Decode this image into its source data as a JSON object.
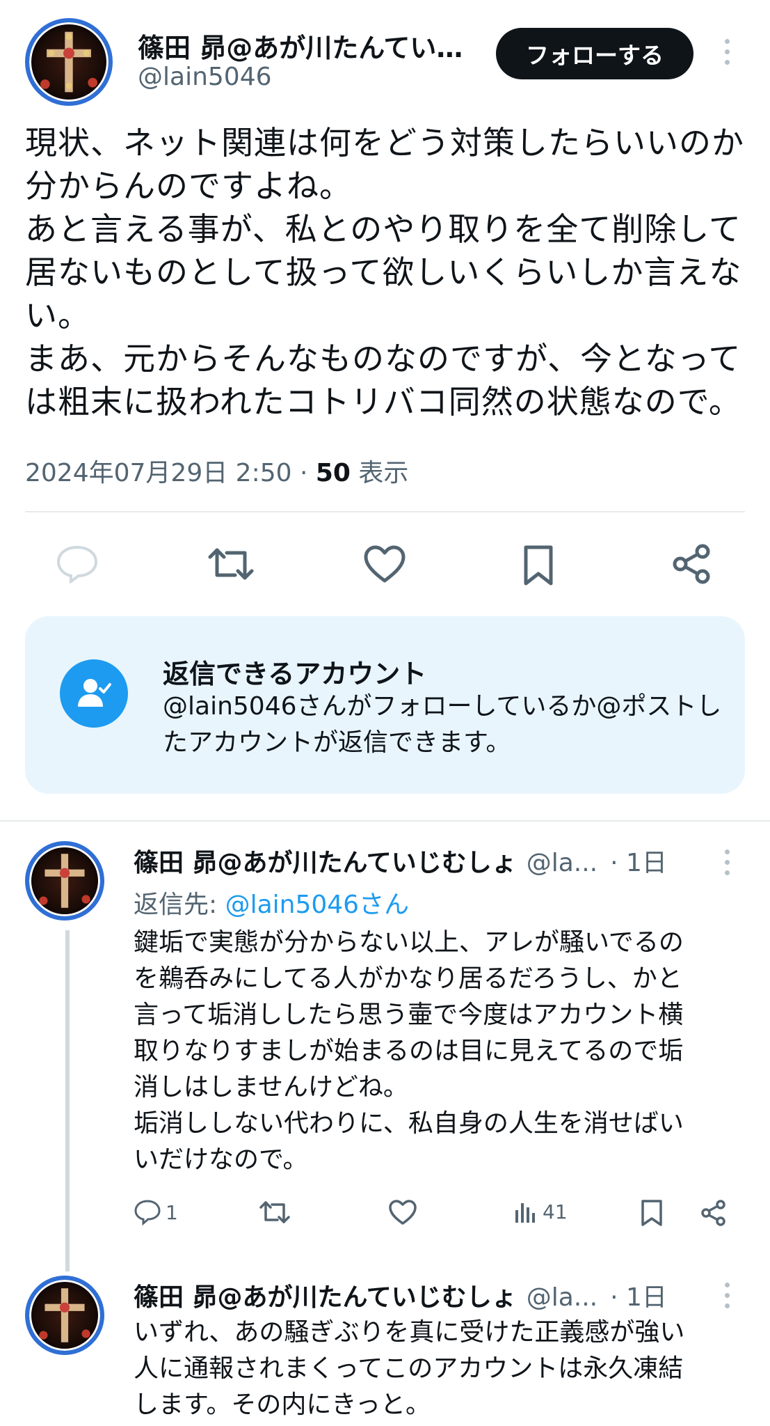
{
  "colors": {
    "accent": "#1d9bf0",
    "text": "#0f1419",
    "muted": "#536471",
    "card_bg": "#e8f5fd"
  },
  "main_post": {
    "author_name": "篠田 昴@あが川たんていじむしょ",
    "author_handle": "@lain5046",
    "follow_label": "フォローする",
    "text": "現状、ネット関連は何をどう対策したらいいのか\n分からんのですよね。\nあと言える事が、私とのやり取りを全て削除して\n居ないものとして扱って欲しいくらいしか言えな\nい。\nまあ、元からそんなものなのですが、今となって\nは粗末に扱われたコトリバコ同然の状態なので。",
    "date": "2024年07月29日 2:50 · ",
    "views": "50",
    "views_label": " 表示",
    "actions": [
      "reply-icon",
      "repost-icon",
      "like-icon",
      "bookmark-icon",
      "share-icon"
    ]
  },
  "reply_restriction": {
    "title": "返信できるアカウント",
    "body": "@lain5046さんがフォローしているか@ポストしたアカウントが返信できます。"
  },
  "replies": [
    {
      "name": "篠田 昴@あが川たんていじむしょ",
      "handle": "@la...",
      "time": "· 1日",
      "reply_to_label": "返信先: ",
      "reply_to": "@lain5046さん",
      "text": "鍵垢で実態が分からない以上、アレが騒いでるの\nを鵜呑みにしてる人がかなり居るだろうし、かと\n言って垢消ししたら思う壷で今度はアカウント横\n取りなりすましが始まるのは目に見えてるので垢\n消しはしませんけどね。\n垢消ししない代わりに、私自身の人生を消せばい\nいだけなので。",
      "reply_count": "1",
      "view_count": "41"
    },
    {
      "name": "篠田 昴@あが川たんていじむしょ",
      "handle": "@la...",
      "time": "· 1日",
      "text": "いずれ、あの騒ぎぶりを真に受けた正義感が強い\n人に通報されまくってこのアカウントは永久凍結\nします。その内にきっと。"
    }
  ]
}
